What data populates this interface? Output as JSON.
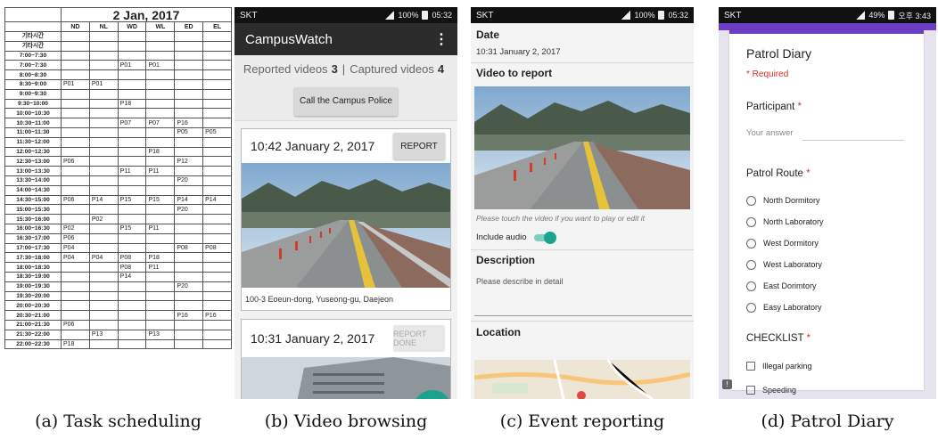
{
  "captions": {
    "a": "(a) Task scheduling",
    "b": "(b) Video browsing",
    "c": "(c) Event reporting",
    "d": "(d) Patrol Diary"
  },
  "schedule": {
    "date": "2 Jan, 2017",
    "columns": [
      "ND",
      "NL",
      "WD",
      "WL",
      "ED",
      "EL"
    ],
    "rows": [
      [
        "기타시간",
        "",
        "",
        "",
        "",
        "",
        ""
      ],
      [
        "기타시간",
        "",
        "",
        "",
        "",
        "",
        ""
      ],
      [
        "7:00~7:30",
        "",
        "",
        "",
        "",
        "",
        ""
      ],
      [
        "7:00~7:30",
        "",
        "",
        "P01",
        "P01",
        "",
        ""
      ],
      [
        "8:00~8:30",
        "",
        "",
        "",
        "",
        "",
        ""
      ],
      [
        "8:30~9:00",
        "P01",
        "P01",
        "",
        "",
        "",
        ""
      ],
      [
        "9:00~9:30",
        "",
        "",
        "",
        "",
        "",
        ""
      ],
      [
        "9:30~10:00",
        "",
        "",
        "P18",
        "",
        "",
        ""
      ],
      [
        "10:00~10:30",
        "",
        "",
        "",
        "",
        "",
        ""
      ],
      [
        "10:30~11:00",
        "",
        "",
        "P07",
        "P07",
        "P16",
        ""
      ],
      [
        "11:00~11:30",
        "",
        "",
        "",
        "",
        "P05",
        "P05"
      ],
      [
        "11:30~12:00",
        "",
        "",
        "",
        "",
        "",
        ""
      ],
      [
        "12:00~12:30",
        "",
        "",
        "",
        "P18",
        "",
        ""
      ],
      [
        "12:30~13:00",
        "P06",
        "",
        "",
        "",
        "P12",
        ""
      ],
      [
        "13:00~13:30",
        "",
        "",
        "P11",
        "P11",
        "",
        ""
      ],
      [
        "13:30~14:00",
        "",
        "",
        "",
        "",
        "P20",
        ""
      ],
      [
        "14:00~14:30",
        "",
        "",
        "",
        "",
        "",
        ""
      ],
      [
        "14:30~15:00",
        "P06",
        "P14",
        "P15",
        "P15",
        "P14",
        "P14"
      ],
      [
        "15:00~15:30",
        "",
        "",
        "",
        "",
        "P20",
        ""
      ],
      [
        "15:30~16:00",
        "",
        "P02",
        "",
        "",
        "",
        ""
      ],
      [
        "16:00~16:30",
        "P02",
        "",
        "P15",
        "P11",
        "",
        ""
      ],
      [
        "16:30~17:00",
        "P06",
        "",
        "",
        "",
        "",
        ""
      ],
      [
        "17:00~17:30",
        "P04",
        "",
        "",
        "",
        "P08",
        "P08"
      ],
      [
        "17:30~18:00",
        "P04",
        "P04",
        "P08",
        "P18",
        "",
        ""
      ],
      [
        "18:00~18:30",
        "",
        "",
        "P08",
        "P11",
        "",
        ""
      ],
      [
        "18:30~19:00",
        "",
        "",
        "P14",
        "",
        "",
        ""
      ],
      [
        "19:00~19:30",
        "",
        "",
        "",
        "",
        "P20",
        ""
      ],
      [
        "19:30~20:00",
        "",
        "",
        "",
        "",
        "",
        ""
      ],
      [
        "20:00~20:30",
        "",
        "",
        "",
        "",
        "",
        ""
      ],
      [
        "20:30~21:00",
        "",
        "",
        "",
        "",
        "P16",
        "P16"
      ],
      [
        "21:00~21:30",
        "P06",
        "",
        "",
        "",
        "",
        ""
      ],
      [
        "21:30~22:00",
        "",
        "P13",
        "",
        "P13",
        "",
        ""
      ],
      [
        "22:00~22:30",
        "P18",
        "",
        "",
        "",
        "",
        ""
      ]
    ]
  },
  "status_b": {
    "carrier": "SKT",
    "battery": "100%",
    "time": "05:32"
  },
  "status_c": {
    "carrier": "SKT",
    "battery": "100%",
    "time": "05:32"
  },
  "status_d": {
    "carrier": "SKT",
    "battery": "49%",
    "time": "오후 3:43"
  },
  "browse": {
    "app_title": "CampusWatch",
    "reported_label": "Reported videos",
    "reported_count": "3",
    "separator": "|",
    "captured_label": "Captured videos",
    "captured_count": "4",
    "call_button": "Call the Campus Police",
    "cards": [
      {
        "time": "10:42 January 2, 2017",
        "button": "REPORT",
        "address": "100-3 Eoeun-dong, Yuseong-gu, Daejeon"
      },
      {
        "time": "10:31 January 2, 2017",
        "button": "REPORT DONE"
      }
    ]
  },
  "report": {
    "date_title": "Date",
    "date_value": "10:31 January 2, 2017",
    "video_title": "Video to report",
    "hint": "Please touch the video if you want to play or edit it",
    "include_audio": "Include audio",
    "description_title": "Description",
    "description_placeholder": "Please describe in detail",
    "location_title": "Location"
  },
  "diary": {
    "title": "Patrol Diary",
    "required": "* Required",
    "participant_q": "Participant",
    "answer_placeholder": "Your answer",
    "route_q": "Patrol Route",
    "routes": [
      "North Dormitory",
      "North Laboratory",
      "West Dormitory",
      "West Laboratory",
      "East Dorimtory",
      "Easy Laboratory"
    ],
    "checklist_q": "CHECKLIST",
    "checks": [
      "Illegal parking",
      "Speeding"
    ],
    "star": "*"
  },
  "colors": {
    "accent_teal": "#1aa48e",
    "form_purple": "#6c3fc4",
    "required_red": "#d93025"
  }
}
